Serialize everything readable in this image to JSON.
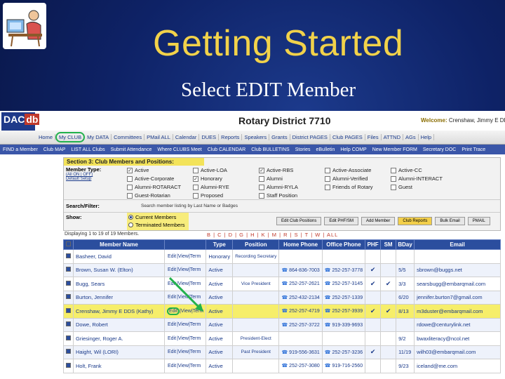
{
  "slide": {
    "title": "Getting Started",
    "subtitle": "Select EDIT Member"
  },
  "site": {
    "logo_main": "DAC",
    "logo_db": "db",
    "district_title": "Rotary District 7710",
    "welcome_label": "Welcome:",
    "welcome_user": "Crenshaw, Jimmy E DDS"
  },
  "nav_main": [
    "Home",
    "My CLUB",
    "My DATA",
    "Committees",
    "PMail ALL",
    "Calendar",
    "DUES",
    "Reports",
    "Speakers",
    "Grants",
    "District PAGES",
    "Club PAGES",
    "Files",
    "ATTND",
    "AGs",
    "Help"
  ],
  "nav_main_active": "My CLUB",
  "nav_sub": [
    "FIND a Member",
    "Club MAP",
    "LIST ALL Clubs",
    "Submit Attendance",
    "Where CLUBS Meet",
    "Club CALENDAR",
    "Club BULLETINS",
    "Stories",
    "eBulletin",
    "Help COMP",
    "New Member FORM",
    "Secretary DOC",
    "Print Trace"
  ],
  "section": {
    "heading": "Section 3: Club Members and Positions:",
    "member_type_label": "Member Type:",
    "all_on_off": "(All ON | OFF)",
    "default_setup": "Default Setup",
    "member_types": [
      {
        "label": "Active",
        "checked": true
      },
      {
        "label": "Active-LOA",
        "checked": false
      },
      {
        "label": "Active-RBS",
        "checked": true
      },
      {
        "label": "Active-Associate",
        "checked": false
      },
      {
        "label": "Active-CC",
        "checked": false
      },
      {
        "label": "Active-Corporate",
        "checked": false
      },
      {
        "label": "Honorary",
        "checked": true
      },
      {
        "label": "Alumni",
        "checked": false
      },
      {
        "label": "Alumni-Verified",
        "checked": false
      },
      {
        "label": "Alumni-INTERACT",
        "checked": false
      },
      {
        "label": "Alumni-ROTARACT",
        "checked": false
      },
      {
        "label": "Alumni-RYE",
        "checked": false
      },
      {
        "label": "Alumni-RYLA",
        "checked": false
      },
      {
        "label": "Friends of Rotary",
        "checked": false
      },
      {
        "label": "Guest",
        "checked": false
      },
      {
        "label": "Guest-Rotarian",
        "checked": false
      },
      {
        "label": "Proposed",
        "checked": false
      },
      {
        "label": "Staff Position",
        "checked": false
      }
    ],
    "search_label": "Search/Filter:",
    "search_hint": "Search member listing by Last Name or Badges",
    "show_label": "Show:",
    "show_options": [
      {
        "label": "Current Members",
        "selected": true
      },
      {
        "label": "Terminated Members",
        "selected": false
      }
    ],
    "buttons": [
      "Edit Club Positions",
      "Edit PHF/SM",
      "Add Member",
      "Club Reports",
      "Bulk Email",
      "PMAIL"
    ],
    "highlight_button": "Club Reports"
  },
  "listing": {
    "displaying": "Displaying 1 to 19 of 19 Members.",
    "letters": "B | C | D | G | H | K | M | R | S | T | W | ALL"
  },
  "table": {
    "headers": [
      "Member Name",
      "Type",
      "Position",
      "Home Phone",
      "Office Phone",
      "PHF",
      "SM",
      "BDay",
      "Email"
    ],
    "link_edit": "Edit",
    "link_view": "View",
    "link_term": "Term",
    "rows": [
      {
        "name": "Basheer, David",
        "type": "Honorary",
        "position": "Recording Secretary",
        "home": "",
        "office": "",
        "phf": "",
        "sm": "",
        "bday": "",
        "email": ""
      },
      {
        "name": "Brown, Susan W. (Elton)",
        "type": "Active",
        "position": "",
        "home": "864-836-7003",
        "office": "252-257-3778",
        "phf": "✔",
        "sm": "",
        "bday": "5/5",
        "email": "sbrown@buggs.net"
      },
      {
        "name": "Bugg, Sears",
        "type": "Active",
        "position": "Vice President",
        "home": "252-257-2621",
        "office": "252-257-3145",
        "phf": "✔",
        "sm": "✔",
        "bday": "3/3",
        "email": "searsbugg@embarqmail.com"
      },
      {
        "name": "Burton, Jennifer",
        "type": "Active",
        "position": "",
        "home": "252-432-2134",
        "office": "252-257-1339",
        "phf": "",
        "sm": "",
        "bday": "6/20",
        "email": "jennifer.burton7@gmail.com"
      },
      {
        "name": "Crenshaw, Jimmy E DDS (Kathy)",
        "type": "Active",
        "position": "",
        "home": "252-257-4719",
        "office": "252-257-3939",
        "phf": "✔",
        "sm": "✔",
        "bday": "8/13",
        "email": "m3duster@embarqmail.com"
      },
      {
        "name": "Dowe, Robert",
        "type": "Active",
        "position": "",
        "home": "252-257-3722",
        "office": "919-339-9693",
        "phf": "",
        "sm": "",
        "bday": "",
        "email": "rdowe@centurylink.net"
      },
      {
        "name": "Griesinger, Roger A.",
        "type": "Active",
        "position": "President-Elect",
        "home": "",
        "office": "",
        "phf": "",
        "sm": "",
        "bday": "9/2",
        "email": "bwaxliteracy@ncol.net"
      },
      {
        "name": "Haight, Wil (LORI)",
        "type": "Active",
        "position": "Past President",
        "home": "919-556-3631",
        "office": "252-257-3236",
        "phf": "✔",
        "sm": "",
        "bday": "11/19",
        "email": "wilh03@embarqmail.com"
      },
      {
        "name": "Holt, Frank",
        "type": "Active",
        "position": "",
        "home": "252-257-3080",
        "office": "919-716-2560",
        "phf": "",
        "sm": "",
        "bday": "9/23",
        "email": "iceland@me.com"
      }
    ],
    "highlight_row": 4
  },
  "colors": {
    "title": "#f2d24a",
    "accent_green": "#22b14c",
    "highlight_yellow": "#f6ee6a",
    "header_blue": "#2b4e9e"
  }
}
